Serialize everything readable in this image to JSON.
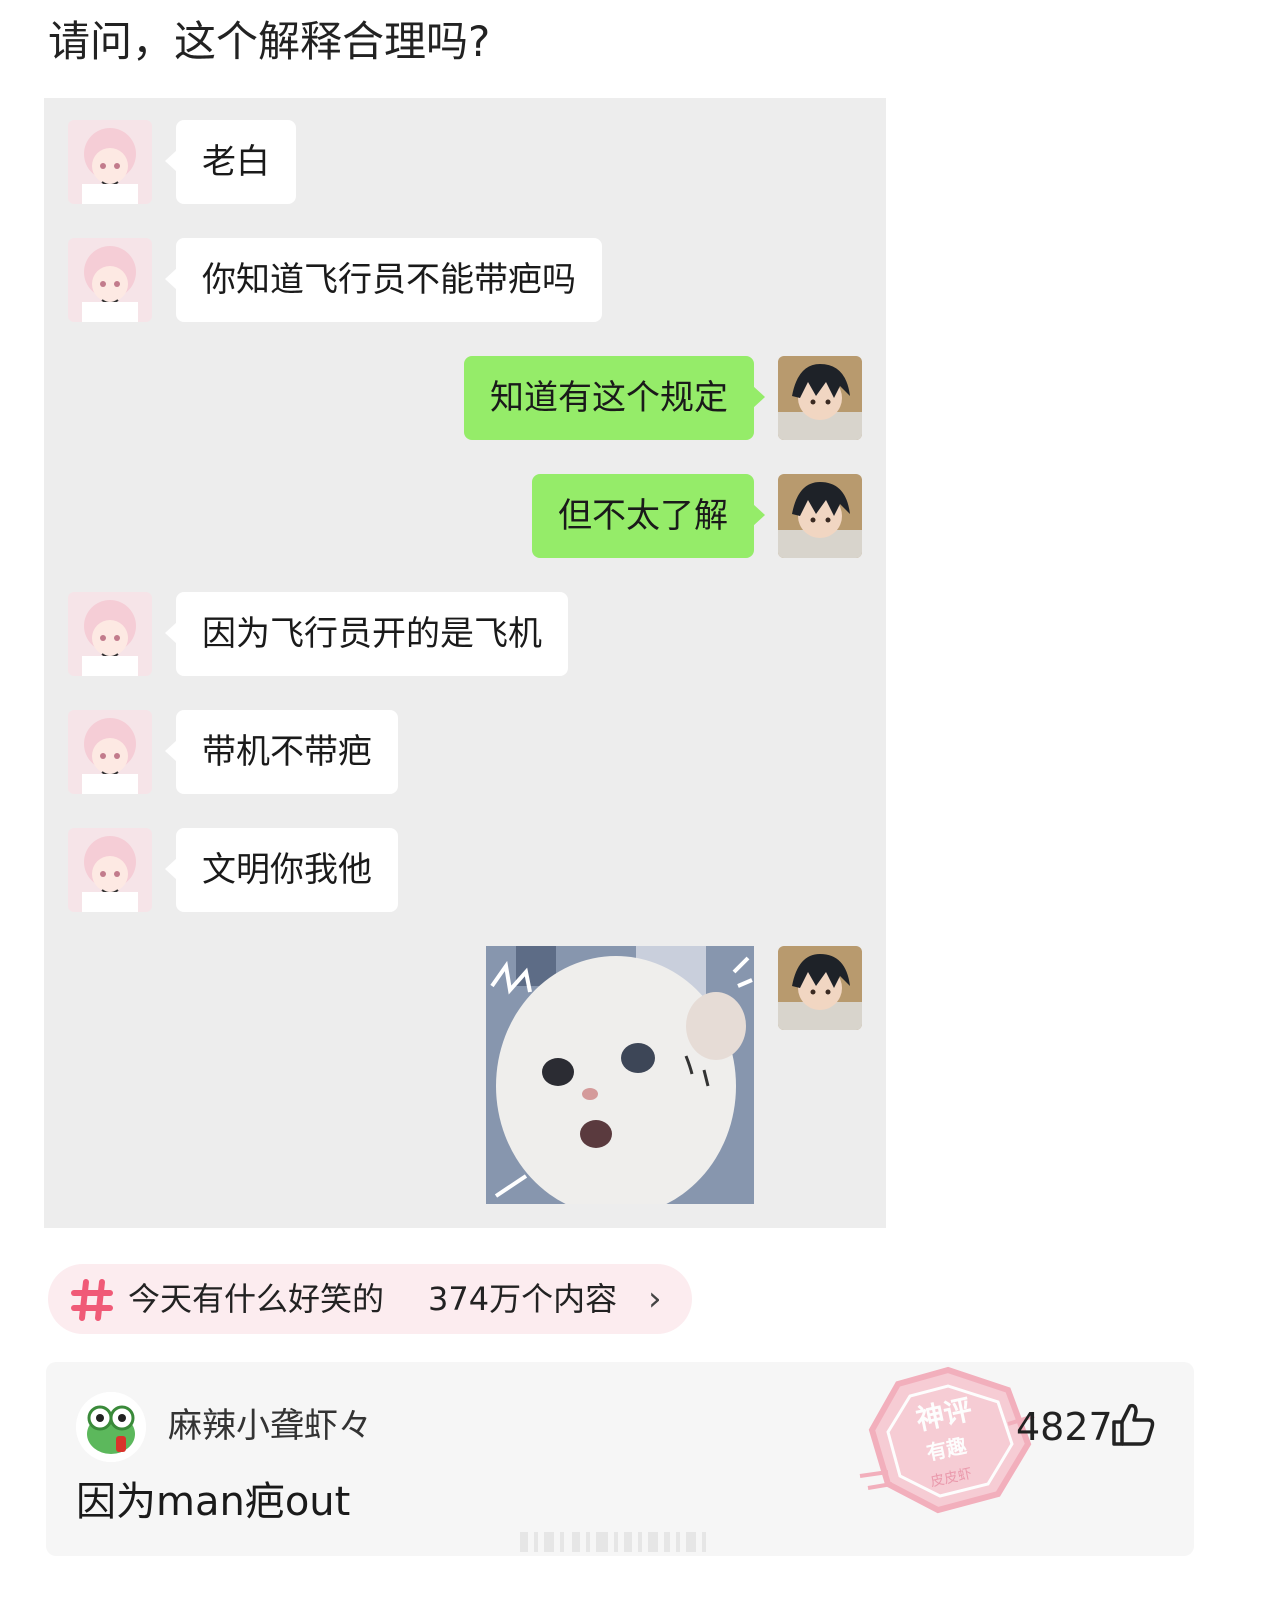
{
  "question": "请问，这个解释合理吗?",
  "messages": [
    {
      "side": "in",
      "text": "老白"
    },
    {
      "side": "in",
      "text": "你知道飞行员不能带疤吗"
    },
    {
      "side": "out",
      "text": "知道有这个规定"
    },
    {
      "side": "out",
      "text": "但不太了解"
    },
    {
      "side": "in",
      "text": "因为飞行员开的是飞机"
    },
    {
      "side": "in",
      "text": "带机不带疤"
    },
    {
      "side": "in",
      "text": "文明你我他"
    },
    {
      "side": "out",
      "type": "sticker",
      "text": ""
    }
  ],
  "topic": {
    "icon": "hash-icon",
    "name": "今天有什么好笑的",
    "count": "374万个内容",
    "chevron": "›"
  },
  "comment": {
    "username": "麻辣小聋虾々",
    "text": "因为man疤out",
    "likes": "4827",
    "stamp": {
      "line1": "神评",
      "line2": "有趣",
      "line3": "皮皮虾"
    }
  },
  "colors": {
    "chat_bg": "#ededed",
    "bubble_in": "#ffffff",
    "bubble_out": "#95ec69",
    "topic_bg": "#fcecef",
    "hash": "#f05a77",
    "stamp": "#f2a3b3"
  }
}
